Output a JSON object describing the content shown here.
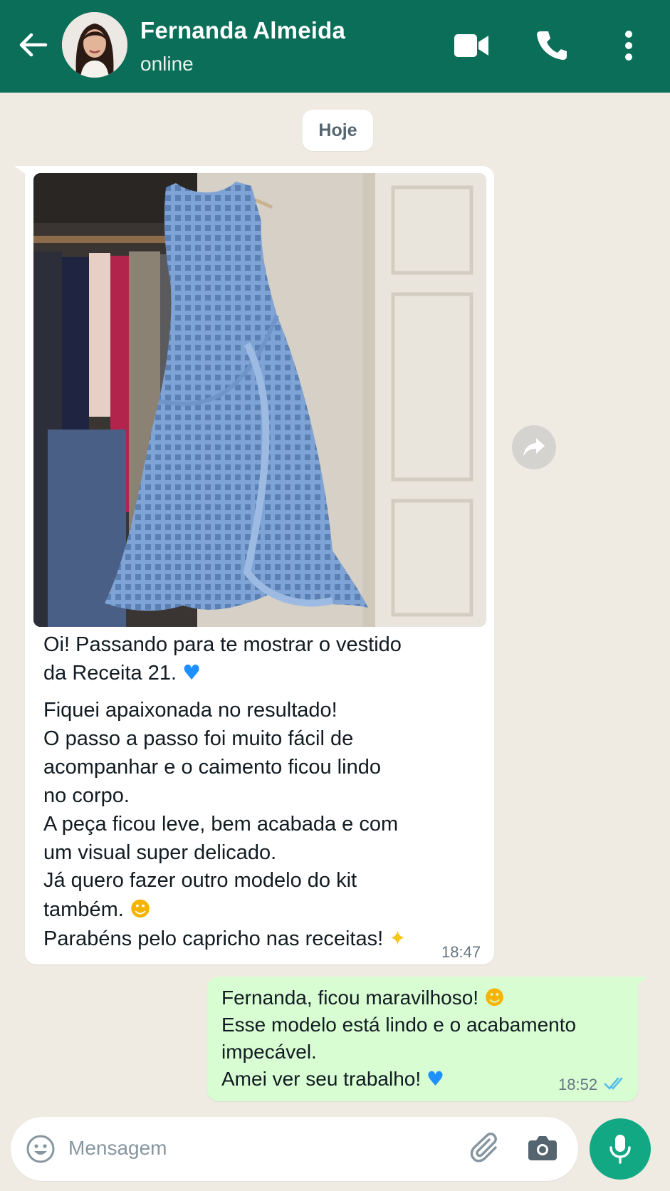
{
  "header": {
    "contact_name": "Fernanda Almeida",
    "status": "online",
    "background": "#0a6e58"
  },
  "icons": {
    "back": "arrow-left-icon",
    "avatar": "profile-photo",
    "video": "video-camera-icon",
    "call": "phone-icon",
    "menu": "more-vertical-icon",
    "forward": "share-forward-icon",
    "emoji": "smiley-icon",
    "attach": "paperclip-icon",
    "camera": "camera-icon",
    "mic": "microphone-icon"
  },
  "chat": {
    "date_label": "Hoje",
    "incoming": {
      "text_lines_1": [
        "Oi! Passando para te mostrar o vestido",
        "da Receita 21."
      ],
      "text_lines_2": [
        "Fiquei apaixonada no resultado!",
        "O passo a passo foi muito fácil de",
        "acompanhar e o caimento ficou lindo",
        "no corpo.",
        "A peça ficou leve, bem acabada e com",
        "um visual super delicado.",
        "Já quero fazer outro modelo do kit",
        "também.",
        "Parabéns pelo capricho nas receitas!"
      ],
      "time": "18:47"
    },
    "outgoing": {
      "lines": [
        "Fernanda, ficou maravilhoso!",
        "Esse modelo está lindo e o acabamento",
        "impecável.",
        "Amei ver seu trabalho!"
      ],
      "time": "18:52",
      "status": "read",
      "bubble_color": "#d9fdd3"
    }
  },
  "input": {
    "placeholder": "Mensagem",
    "mic_color": "#13a884"
  }
}
